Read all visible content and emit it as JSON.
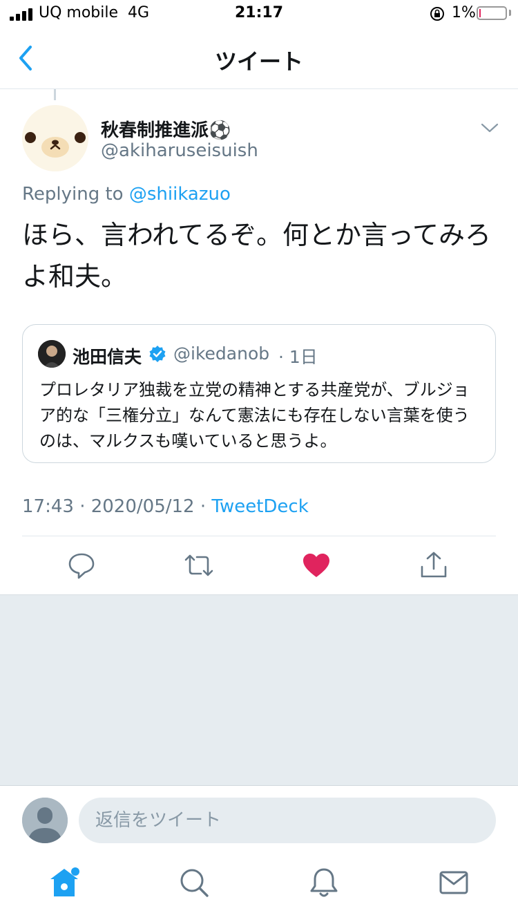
{
  "status_bar": {
    "carrier": "UQ mobile",
    "network": "4G",
    "time": "21:17",
    "battery_percent": "1%",
    "battery_level": 0.01
  },
  "nav": {
    "title": "ツイート",
    "back_icon": "chevron-left-icon"
  },
  "tweet": {
    "author_name": "秋春制推進派⚽️",
    "author_handle": "@akiharuseisuish",
    "replying_prefix": "Replying to ",
    "replying_to": "@shiikazuo",
    "text": "ほら、言われてるぞ。何とか言ってみろよ和夫。",
    "timestamp": "17:43 · 2020/05/12 · ",
    "source": "TweetDeck",
    "liked": true
  },
  "quote": {
    "name": "池田信夫",
    "handle": "@ikedanob",
    "time": "· 1日",
    "text": "プロレタリア独裁を立党の精神とする共産党が、ブルジョア的な「三権分立」なんて憲法にも存在しない言葉を使うのは、マルクスも嘆いていると思うよ。"
  },
  "actions": {
    "reply_icon": "reply-icon",
    "retweet_icon": "retweet-icon",
    "like_icon": "heart-icon",
    "share_icon": "share-icon"
  },
  "compose": {
    "placeholder": "返信をツイート"
  },
  "tabbar": {
    "items": [
      "home-icon",
      "search-icon",
      "notifications-icon",
      "messages-icon"
    ],
    "home_has_badge": true
  },
  "colors": {
    "accent": "#1da1f2",
    "like": "#e0245e",
    "muted": "#657786",
    "background_empty": "#e6ecf0"
  }
}
